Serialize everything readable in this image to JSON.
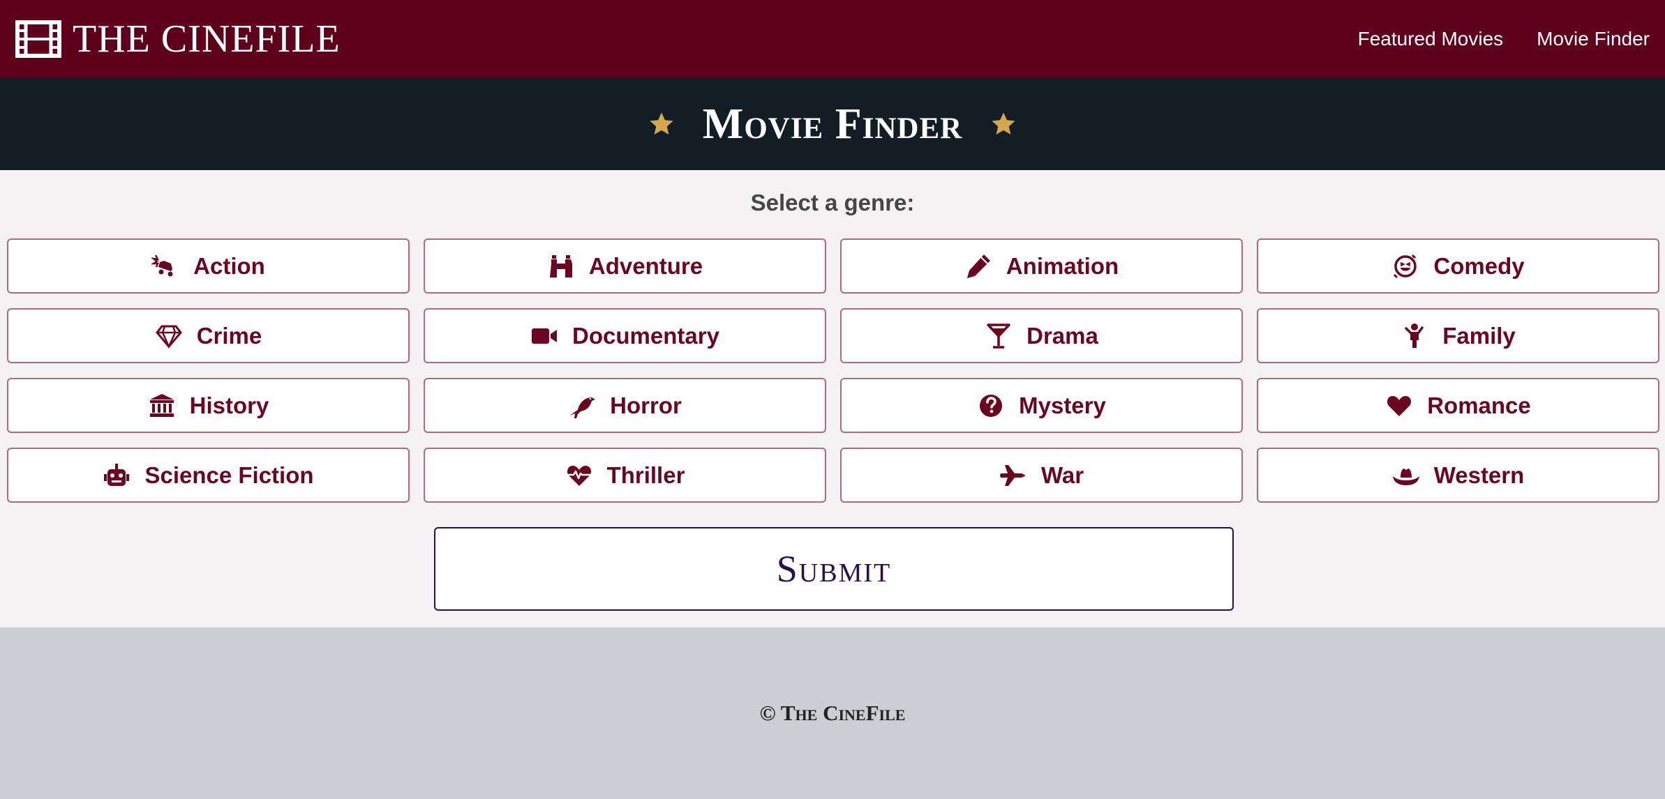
{
  "header": {
    "brand": "THE CINEFILE",
    "brand_icon": "film-icon",
    "nav": [
      "Featured Movies",
      "Movie Finder"
    ]
  },
  "banner": {
    "title": "Movie Finder",
    "star_color": "#d4a74f"
  },
  "main": {
    "prompt": "Select a genre:",
    "genres": [
      {
        "label": "Action",
        "icon": "car-crash-icon"
      },
      {
        "label": "Adventure",
        "icon": "binoculars-icon"
      },
      {
        "label": "Animation",
        "icon": "pencil-icon"
      },
      {
        "label": "Comedy",
        "icon": "laugh-icon"
      },
      {
        "label": "Crime",
        "icon": "gem-icon"
      },
      {
        "label": "Documentary",
        "icon": "video-camera-icon"
      },
      {
        "label": "Drama",
        "icon": "cocktail-glass-icon"
      },
      {
        "label": "Family",
        "icon": "child-icon"
      },
      {
        "label": "History",
        "icon": "landmark-icon"
      },
      {
        "label": "Horror",
        "icon": "crow-icon"
      },
      {
        "label": "Mystery",
        "icon": "question-circle-icon"
      },
      {
        "label": "Romance",
        "icon": "heart-icon"
      },
      {
        "label": "Science Fiction",
        "icon": "robot-icon"
      },
      {
        "label": "Thriller",
        "icon": "heart-pulse-icon"
      },
      {
        "label": "War",
        "icon": "fighter-jet-icon"
      },
      {
        "label": "Western",
        "icon": "cowboy-hat-icon"
      }
    ],
    "submit_label": "Submit"
  },
  "footer": {
    "copyright": "© The CineFile"
  },
  "colors": {
    "navbar": "#5e001b",
    "banner": "#121d26",
    "accent": "#6b0620",
    "submit": "#25104a",
    "footer": "#cbcfd2"
  }
}
